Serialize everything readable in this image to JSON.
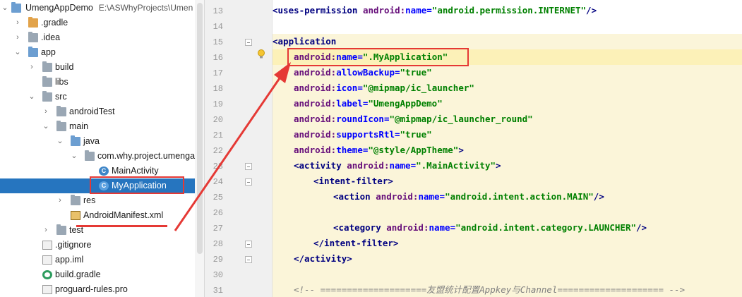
{
  "tree": {
    "project": "UmengAppDemo",
    "project_path": "E:\\ASWhyProjects\\Umen",
    "items": [
      {
        "label": ".gradle"
      },
      {
        "label": ".idea"
      },
      {
        "label": "app"
      },
      {
        "label": "build"
      },
      {
        "label": "libs"
      },
      {
        "label": "src"
      },
      {
        "label": "androidTest"
      },
      {
        "label": "main"
      },
      {
        "label": "java"
      },
      {
        "label": "com.why.project.umengap"
      },
      {
        "label": "MainActivity"
      },
      {
        "label": "MyApplication"
      },
      {
        "label": "res"
      },
      {
        "label": "AndroidManifest.xml"
      },
      {
        "label": "test"
      },
      {
        "label": ".gitignore"
      },
      {
        "label": "app.iml"
      },
      {
        "label": "build.gradle"
      },
      {
        "label": "proguard-rules.pro"
      }
    ]
  },
  "editor": {
    "line_numbers": [
      "13",
      "14",
      "15",
      "16",
      "17",
      "18",
      "19",
      "20",
      "21",
      "22",
      "23",
      "24",
      "25",
      "26",
      "27",
      "28",
      "29",
      "30",
      "31"
    ],
    "lines": {
      "l13_tag": "<uses-permission ",
      "l13_ns": "android:",
      "l13_attr": "name=",
      "l13_val": "\"android.permission.INTERNET\"",
      "l13_end": "/>",
      "l15_tag": "<application",
      "l16_ns": "android:",
      "l16_attr": "name=",
      "l16_val": "\".MyApplication\"",
      "l17_ns": "android:",
      "l17_attr": "allowBackup=",
      "l17_val": "\"true\"",
      "l18_ns": "android:",
      "l18_attr": "icon=",
      "l18_val": "\"@mipmap/ic_launcher\"",
      "l19_ns": "android:",
      "l19_attr": "label=",
      "l19_val": "\"UmengAppDemo\"",
      "l20_ns": "android:",
      "l20_attr": "roundIcon=",
      "l20_val": "\"@mipmap/ic_launcher_round\"",
      "l21_ns": "android:",
      "l21_attr": "supportsRtl=",
      "l21_val": "\"true\"",
      "l22_ns": "android:",
      "l22_attr": "theme=",
      "l22_val": "\"@style/AppTheme\"",
      "l22_end": ">",
      "l23_tag": "<activity ",
      "l23_ns": "android:",
      "l23_attr": "name=",
      "l23_val": "\".MainActivity\"",
      "l23_end": ">",
      "l24_tag": "<intent-filter>",
      "l25_tag": "<action ",
      "l25_ns": "android:",
      "l25_attr": "name=",
      "l25_val": "\"android.intent.action.MAIN\"",
      "l25_end": "/>",
      "l27_tag": "<category ",
      "l27_ns": "android:",
      "l27_attr": "name=",
      "l27_val": "\"android.intent.category.LAUNCHER\"",
      "l27_end": "/>",
      "l28_tag": "</intent-filter>",
      "l29_tag": "</activity>",
      "l31_cmt": "<!-- ====================友盟统计配置Appkey与Channel==================== -->"
    }
  },
  "colors": {
    "selection": "#2675bf",
    "annotation_red": "#e53935",
    "code_bg": "#fbf5d9"
  }
}
